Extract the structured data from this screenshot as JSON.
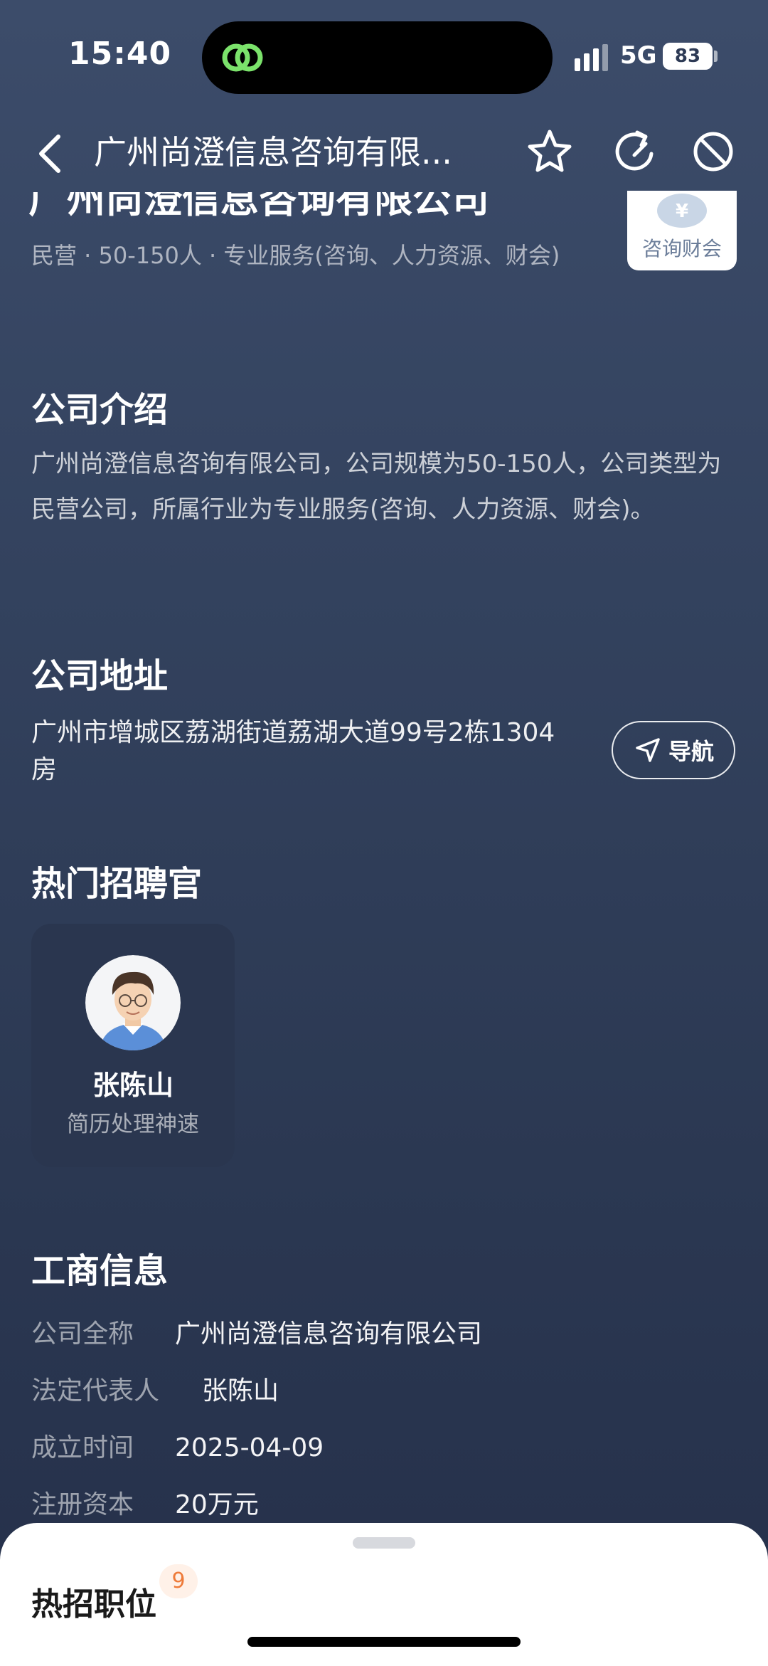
{
  "status_bar": {
    "time": "15:40",
    "network": "5G",
    "battery": "83"
  },
  "nav": {
    "title": "广州尚澄信息咨询有限..."
  },
  "company": {
    "name": "广州尚澄信息咨询有限公司",
    "meta": "民营 · 50-150人 · 专业服务(咨询、人力资源、财会)",
    "industry_badge": "咨询财会"
  },
  "intro": {
    "title": "公司介绍",
    "text": "广州尚澄信息咨询有限公司，公司规模为50-150人，公司类型为民营公司，所属行业为专业服务(咨询、人力资源、财会)。"
  },
  "address": {
    "title": "公司地址",
    "text": "广州市增城区荔湖街道荔湖大道99号2栋1304房",
    "navigate_label": "导航"
  },
  "recruiters": {
    "title": "热门招聘官",
    "items": [
      {
        "name": "张陈山",
        "tag": "简历处理神速"
      }
    ]
  },
  "business_info": {
    "title": "工商信息",
    "rows": [
      {
        "label": "公司全称",
        "value": "广州尚澄信息咨询有限公司"
      },
      {
        "label": "法定代表人",
        "value": "张陈山"
      },
      {
        "label": "成立时间",
        "value": "2025-04-09"
      },
      {
        "label": "注册资本",
        "value": "20万元"
      }
    ]
  },
  "bottom_sheet": {
    "title": "热招职位",
    "count": "9"
  },
  "colors": {
    "background_top": "#3c4c6a",
    "background_bottom": "#25304a",
    "badge_orange": "#ee7b3a",
    "card_bg": "#2a364f"
  }
}
